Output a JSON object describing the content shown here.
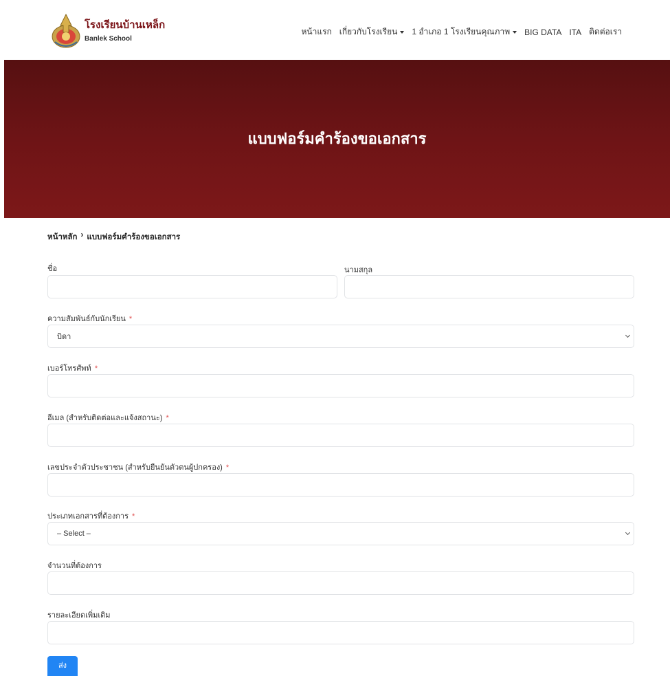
{
  "header": {
    "brand_name": "โรงเรียนบ้านเหล็ก",
    "brand_sub": "Banlek School",
    "nav": [
      {
        "label": "หน้าแรก",
        "dropdown": false
      },
      {
        "label": "เกี่ยวกับโรงเรียน",
        "dropdown": true
      },
      {
        "label": "1 อำเภอ 1 โรงเรียนคุณภาพ",
        "dropdown": true
      },
      {
        "label": "BIG DATA",
        "dropdown": false
      },
      {
        "label": "ITA",
        "dropdown": false
      },
      {
        "label": "ติดต่อเรา",
        "dropdown": false
      }
    ]
  },
  "hero": {
    "title": "แบบฟอร์มคำร้องขอเอกสาร"
  },
  "breadcrumb": {
    "home": "หน้าหลัก",
    "separator": "›",
    "current": "แบบฟอร์มคำร้องขอเอกสาร"
  },
  "form": {
    "first_name": {
      "label": "ชื่อ",
      "value": ""
    },
    "last_name": {
      "label": "นามสกุล",
      "value": ""
    },
    "relation": {
      "label": "ความสัมพันธ์กับนักเรียน",
      "required": "*",
      "value": "บิดา"
    },
    "phone": {
      "label": "เบอร์โทรศัพท์",
      "required": "*",
      "value": ""
    },
    "email": {
      "label": "อีเมล (สำหรับติดต่อและแจ้งสถานะ)",
      "required": "*",
      "value": ""
    },
    "id_card": {
      "label": "เลขประจำตัวประชาชน (สำหรับยืนยันตัวตนผู้ปกครอง)",
      "required": "*",
      "value": ""
    },
    "doc_type": {
      "label": "ประเภทเอกสารที่ต้องการ",
      "required": "*",
      "value": "– Select –"
    },
    "quantity": {
      "label": "จำนวนที่ต้องการ",
      "value": ""
    },
    "details": {
      "label": "รายละเอียดเพิ่มเติม",
      "value": ""
    },
    "submit_label": "ส่ง"
  },
  "colors": {
    "brand": "#7a1216",
    "hero": "#6e1416",
    "button": "#2185f4",
    "required": "#e05050"
  }
}
